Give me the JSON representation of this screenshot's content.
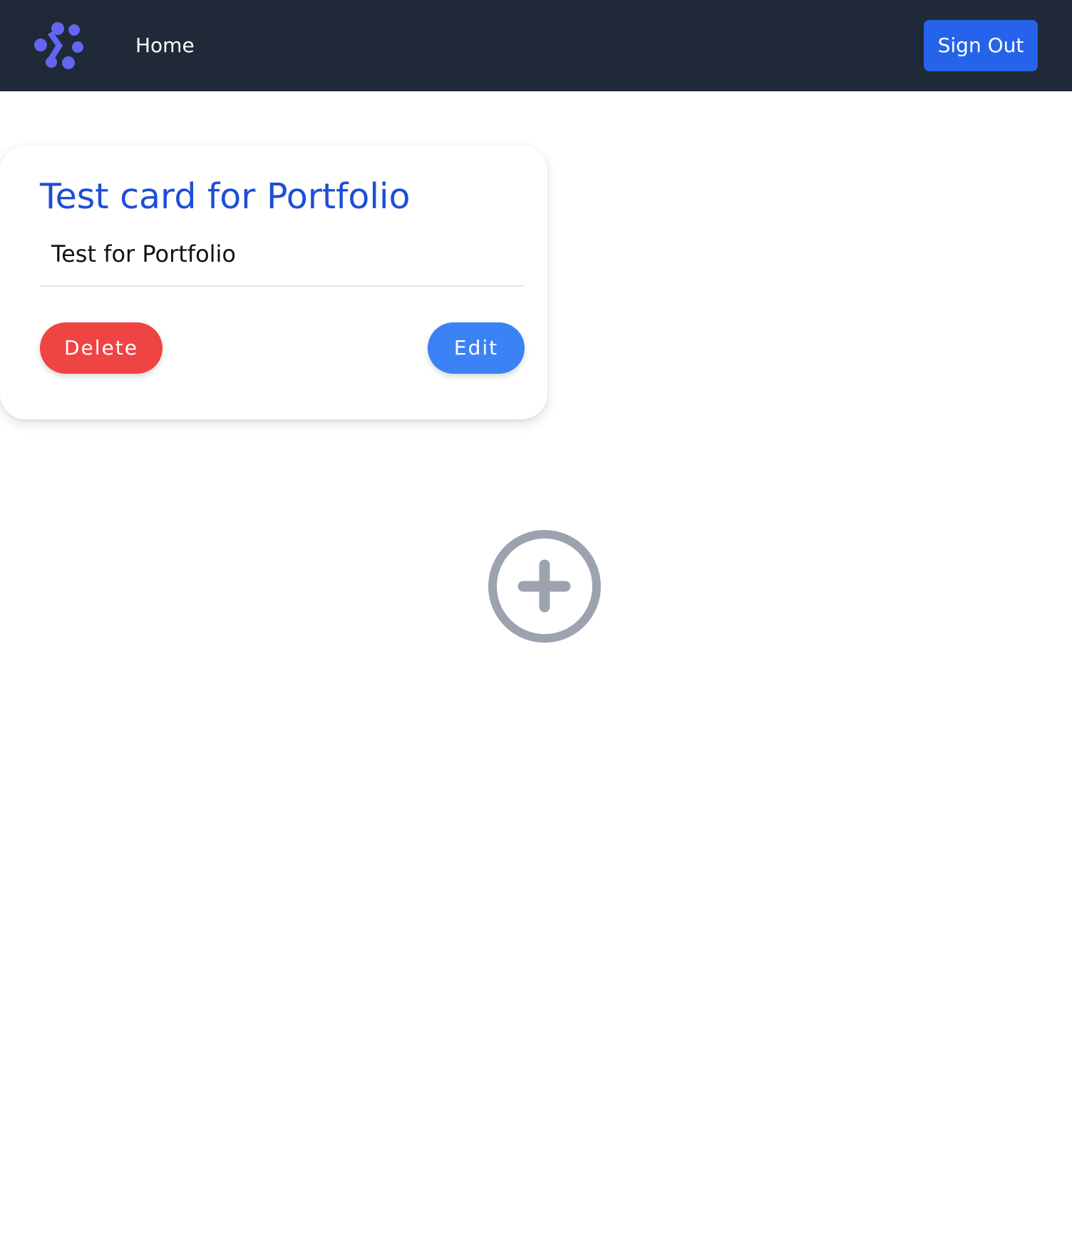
{
  "header": {
    "logo_icon": "dots-logo-icon",
    "nav": {
      "home_label": "Home"
    },
    "sign_out_label": "Sign Out"
  },
  "cards": [
    {
      "title": "Test card for Portfolio",
      "description": "Test for Portfolio",
      "delete_label": "Delete",
      "edit_label": "Edit"
    }
  ],
  "add_button": {
    "icon": "plus-circle-icon"
  },
  "colors": {
    "topbar": "#1f2937",
    "logo": "#6366f1",
    "sign_out": "#2563eb",
    "card_title": "#1d4ed8",
    "delete": "#ef4444",
    "edit": "#3b82f6",
    "add_icon": "#9ca3af"
  }
}
